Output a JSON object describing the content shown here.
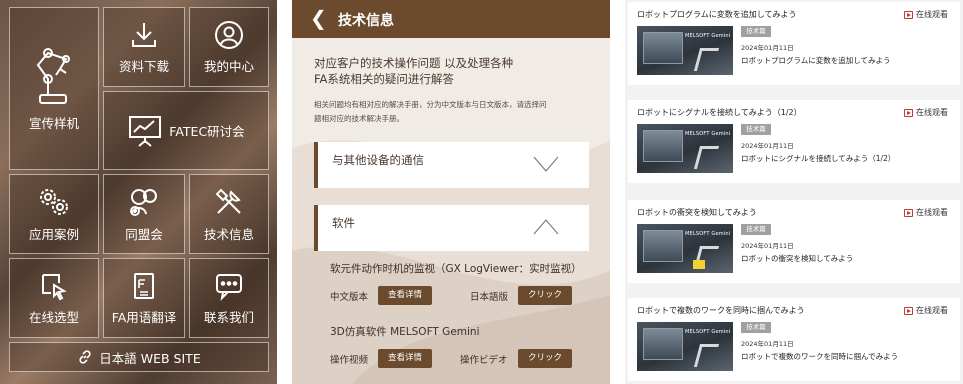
{
  "menu": {
    "tiles": [
      {
        "label": "宣传样机",
        "icon": "robot-arm-icon"
      },
      {
        "label": "资料下载",
        "icon": "download-icon"
      },
      {
        "label": "我的中心",
        "icon": "user-icon"
      },
      {
        "label": "FATEC研讨会",
        "icon": "presentation-board-icon"
      },
      {
        "label": "应用案例",
        "icon": "gears-icon"
      },
      {
        "label": "同盟会",
        "icon": "people-icon"
      },
      {
        "label": "技术信息",
        "icon": "tools-icon"
      },
      {
        "label": "在线选型",
        "icon": "cursor-select-icon"
      },
      {
        "label": "FA用语翻译",
        "icon": "dictionary-icon"
      },
      {
        "label": "联系我们",
        "icon": "chat-icon"
      }
    ],
    "website": {
      "label": "日本語 WEB SITE",
      "icon": "link-icon"
    }
  },
  "tech": {
    "header_title": "技术信息",
    "headline_line1": "对应客户的技术操作问题 以及处理各种",
    "headline_line2": "FA系统相关的疑问进行解答",
    "desc_line1": "相关问题均有相对应的解决手册，分为中文版本与日文版本，请选择问",
    "desc_line2": "题相对应的技术解决手册。",
    "sections": [
      {
        "title": "与其他设备的通信",
        "state": "collapsed"
      },
      {
        "title": "软件",
        "state": "expanded"
      }
    ],
    "items": [
      {
        "title": "软元件动作时机的监视（GX LogViewer：实时监视）",
        "left_label": "中文版本",
        "left_button": "查看详情",
        "right_label": "日本語版",
        "right_button": "クリック"
      },
      {
        "title": "3D仿真软件 MELSOFT Gemini",
        "left_label": "操作视频",
        "left_button": "查看详情",
        "right_label": "操作ビデオ",
        "right_button": "クリック"
      }
    ]
  },
  "videos": {
    "watch_label": "在线观看",
    "thumb_brand": "MELSOFT Gemini",
    "list": [
      {
        "title": "ロボットプログラムに変数を追加してみよう",
        "tag": "技术篇",
        "date": "2024年01月11日",
        "lesson": "ロボットプログラムに変数を追加してみよう"
      },
      {
        "title": "ロボットにシグナルを接続してみよう（1/2）",
        "tag": "技术篇",
        "date": "2024年01月11日",
        "lesson": "ロボットにシグナルを接続してみよう（1/2）"
      },
      {
        "title": "ロボットの衝突を検知してみよう",
        "tag": "技术篇",
        "date": "2024年01月11日",
        "lesson": "ロボットの衝突を検知してみよう"
      },
      {
        "title": "ロボットで複数のワークを同時に掴んでみよう",
        "tag": "技术篇",
        "date": "2024年01月11日",
        "lesson": "ロボットで複数のワークを同時に掴んでみよう"
      }
    ]
  },
  "colors": {
    "brand_brown": "#6b4a2e",
    "accent_red": "#c23a2f",
    "tag_gray": "#a0a0a0"
  }
}
